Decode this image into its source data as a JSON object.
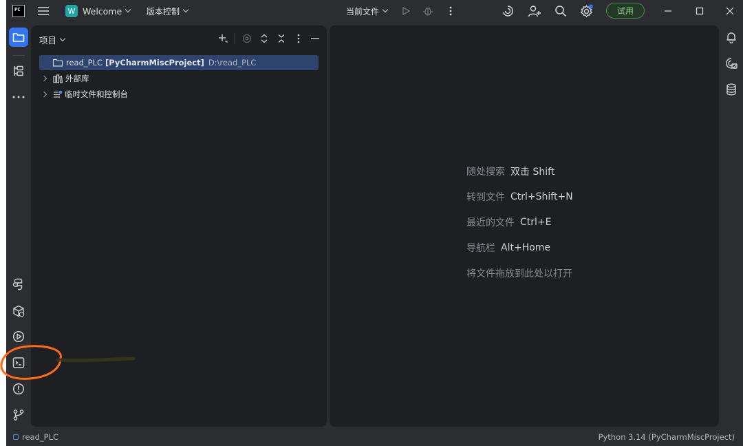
{
  "titlebar": {
    "app_logo_text": "PC",
    "project_badge": "W",
    "project_name": "Welcome",
    "vcs_label": "版本控制",
    "run_config": "当前文件",
    "trial_label": "试用"
  },
  "project_panel": {
    "title": "项目",
    "tree": {
      "root": {
        "name": "read_PLC",
        "project": "[PyCharmMiscProject]",
        "path": "D:\\read_PLC"
      },
      "external_libs": "外部库",
      "scratches": "临时文件和控制台"
    }
  },
  "editor": {
    "hints": [
      {
        "label": "随处搜索",
        "keys": "双击 Shift"
      },
      {
        "label": "转到文件",
        "keys": "Ctrl+Shift+N"
      },
      {
        "label": "最近的文件",
        "keys": "Ctrl+E"
      },
      {
        "label": "导航栏",
        "keys": "Alt+Home"
      }
    ],
    "drop_hint": "将文件拖放到此处以打开"
  },
  "statusbar": {
    "project": "read_PLC",
    "interpreter": "Python 3.14 (PyCharmMiscProject)"
  },
  "colors": {
    "accent": "#3574f0",
    "annotation": "#ff6a13",
    "trial_green": "#8fd593"
  },
  "icons": [
    "menu-icon",
    "run-icon",
    "debug-icon",
    "more-icon",
    "ai-assistant-icon",
    "add-user-icon",
    "search-icon",
    "settings-icon",
    "minimize-icon",
    "maximize-icon",
    "close-icon",
    "folder-icon",
    "structure-icon",
    "python-console-icon",
    "python-packages-icon",
    "services-icon",
    "terminal-icon",
    "problems-icon",
    "git-icon",
    "notifications-icon",
    "ai-chat-icon",
    "database-icon"
  ]
}
